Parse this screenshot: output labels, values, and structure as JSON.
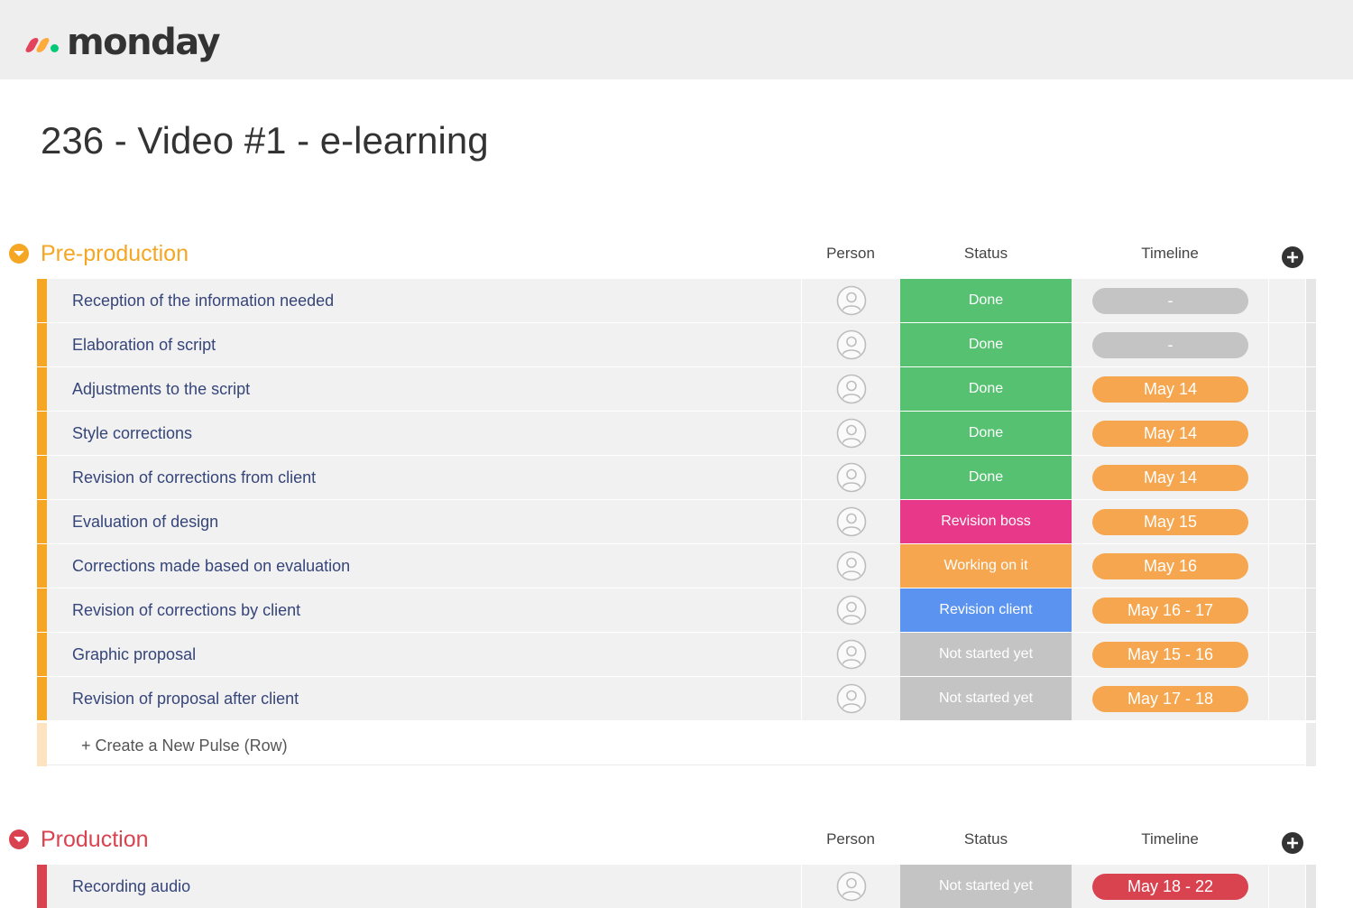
{
  "app": {
    "logo_text": "monday",
    "logo_colors": [
      "#e2445c",
      "#fdab3d",
      "#00c875"
    ]
  },
  "page_title": "236 - Video #1 - e-learning",
  "columns": {
    "person": "Person",
    "status": "Status",
    "timeline": "Timeline"
  },
  "groups": [
    {
      "title": "Pre-production",
      "color": "#f5a623",
      "rows": [
        {
          "name": "Reception of the information needed",
          "status": "Done",
          "status_color": "#56c271",
          "timeline": "-",
          "timeline_color": "#c4c4c4"
        },
        {
          "name": "Elaboration of script",
          "status": "Done",
          "status_color": "#56c271",
          "timeline": "-",
          "timeline_color": "#c4c4c4"
        },
        {
          "name": "Adjustments to the script",
          "status": "Done",
          "status_color": "#56c271",
          "timeline": "May 14",
          "timeline_color": "#f5a64e"
        },
        {
          "name": "Style corrections",
          "status": "Done",
          "status_color": "#56c271",
          "timeline": "May 14",
          "timeline_color": "#f5a64e"
        },
        {
          "name": "Revision of corrections from client",
          "status": "Done",
          "status_color": "#56c271",
          "timeline": "May 14",
          "timeline_color": "#f5a64e"
        },
        {
          "name": "Evaluation of design",
          "status": "Revision boss",
          "status_color": "#e8388a",
          "timeline": "May 15",
          "timeline_color": "#f5a64e"
        },
        {
          "name": "Corrections made based on evaluation",
          "status": "Working on it",
          "status_color": "#f5a64e",
          "timeline": "May 16",
          "timeline_color": "#f5a64e"
        },
        {
          "name": "Revision of corrections by client",
          "status": "Revision client",
          "status_color": "#5b94f0",
          "timeline": "May 16 - 17",
          "timeline_color": "#f5a64e"
        },
        {
          "name": "Graphic proposal",
          "status": "Not started yet",
          "status_color": "#c4c4c4",
          "timeline": "May 15 - 16",
          "timeline_color": "#f5a64e"
        },
        {
          "name": "Revision of proposal after client",
          "status": "Not started yet",
          "status_color": "#c4c4c4",
          "timeline": "May 17 - 18",
          "timeline_color": "#f5a64e"
        }
      ],
      "new_row_label": "+ Create a New Pulse (Row)"
    },
    {
      "title": "Production",
      "color": "#d9434f",
      "rows": [
        {
          "name": "Recording audio",
          "status": "Not started yet",
          "status_color": "#c4c4c4",
          "timeline": "May 18 - 22",
          "timeline_color": "#d9434f"
        }
      ]
    }
  ]
}
